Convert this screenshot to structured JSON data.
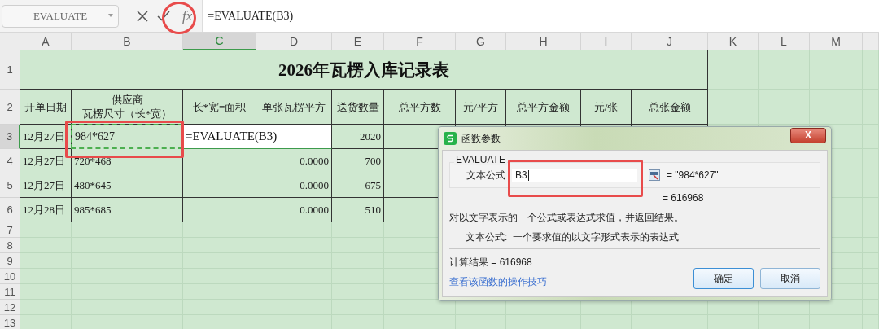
{
  "formula_bar": {
    "name_box": "EVALUATE",
    "fx_label": "fx",
    "formula": "=EVALUATE(B3)"
  },
  "columns": [
    {
      "label": "A",
      "selected": false
    },
    {
      "label": "B",
      "selected": false
    },
    {
      "label": "C",
      "selected": true
    },
    {
      "label": "D",
      "selected": false
    },
    {
      "label": "E",
      "selected": false
    },
    {
      "label": "F",
      "selected": false
    },
    {
      "label": "G",
      "selected": false
    },
    {
      "label": "H",
      "selected": false
    },
    {
      "label": "I",
      "selected": false
    },
    {
      "label": "J",
      "selected": false
    },
    {
      "label": "K",
      "selected": false
    },
    {
      "label": "L",
      "selected": false
    },
    {
      "label": "M",
      "selected": false
    }
  ],
  "row_numbers": [
    {
      "label": "1",
      "selected": false
    },
    {
      "label": "2",
      "selected": false
    },
    {
      "label": "3",
      "selected": true
    },
    {
      "label": "4",
      "selected": false
    },
    {
      "label": "5",
      "selected": false
    },
    {
      "label": "6",
      "selected": false
    },
    {
      "label": "7",
      "selected": false
    },
    {
      "label": "8",
      "selected": false
    },
    {
      "label": "9",
      "selected": false
    },
    {
      "label": "10",
      "selected": false
    },
    {
      "label": "11",
      "selected": false
    },
    {
      "label": "12",
      "selected": false
    },
    {
      "label": "13",
      "selected": false
    }
  ],
  "sheet_title": "2026年瓦楞入库记录表",
  "headers": [
    [
      "开单日期"
    ],
    [
      "供应商",
      "瓦楞尺寸（长*宽）"
    ],
    [
      "长*宽=面积"
    ],
    [
      "单张瓦楞平方"
    ],
    [
      "送货数量"
    ],
    [
      "总平方数"
    ],
    [
      "元/平方"
    ],
    [
      "总平方金额"
    ],
    [
      "元/张"
    ],
    [
      "总张金额"
    ]
  ],
  "data_rows": [
    {
      "cells": [
        {
          "kind": "text",
          "text": "12月27日"
        },
        {
          "kind": "marquee",
          "text": "984*627"
        },
        {
          "kind": "editing",
          "text": "=EVALUATE(B3)"
        },
        {
          "kind": "number",
          "text": "2020"
        },
        {
          "kind": "text",
          "text": ""
        },
        {
          "kind": "text",
          "text": ""
        },
        {
          "kind": "text",
          "text": ""
        },
        {
          "kind": "text",
          "text": ""
        },
        {
          "kind": "text",
          "text": ""
        }
      ]
    },
    {
      "cells": [
        {
          "kind": "text",
          "text": "12月27日"
        },
        {
          "kind": "text",
          "text": "720*468"
        },
        {
          "kind": "text",
          "text": ""
        },
        {
          "kind": "number",
          "text": "0.0000"
        },
        {
          "kind": "number",
          "text": "700"
        },
        {
          "kind": "text",
          "text": ""
        },
        {
          "kind": "text",
          "text": ""
        },
        {
          "kind": "text",
          "text": ""
        },
        {
          "kind": "text",
          "text": ""
        },
        {
          "kind": "text",
          "text": ""
        }
      ]
    },
    {
      "cells": [
        {
          "kind": "text",
          "text": "12月27日"
        },
        {
          "kind": "text",
          "text": "480*645"
        },
        {
          "kind": "text",
          "text": ""
        },
        {
          "kind": "number",
          "text": "0.0000"
        },
        {
          "kind": "number",
          "text": "675"
        },
        {
          "kind": "text",
          "text": ""
        },
        {
          "kind": "text",
          "text": ""
        },
        {
          "kind": "text",
          "text": ""
        },
        {
          "kind": "text",
          "text": ""
        },
        {
          "kind": "text",
          "text": ""
        }
      ]
    },
    {
      "cells": [
        {
          "kind": "text",
          "text": "12月28日"
        },
        {
          "kind": "text",
          "text": "985*685"
        },
        {
          "kind": "text",
          "text": ""
        },
        {
          "kind": "number",
          "text": "0.0000"
        },
        {
          "kind": "number",
          "text": "510"
        },
        {
          "kind": "text",
          "text": ""
        },
        {
          "kind": "text",
          "text": ""
        },
        {
          "kind": "text",
          "text": ""
        },
        {
          "kind": "text",
          "text": ""
        },
        {
          "kind": "text",
          "text": ""
        }
      ]
    }
  ],
  "dialog": {
    "title": "函数参数",
    "close_label": "X",
    "function_name": "EVALUATE",
    "argument_label": "文本公式",
    "argument_value": "B3",
    "argument_preview": "= \"984*627\"",
    "result_preview": "= 616968",
    "description": "对以文字表示的一个公式或表达式求值，并返回结果。",
    "argument_help": "文本公式:  一个要求值的以文字形式表示的表达式",
    "calc_result": "计算结果 = 616968",
    "help_link": "查看该函数的操作技巧",
    "buttons": [
      "确定",
      "取消"
    ]
  }
}
